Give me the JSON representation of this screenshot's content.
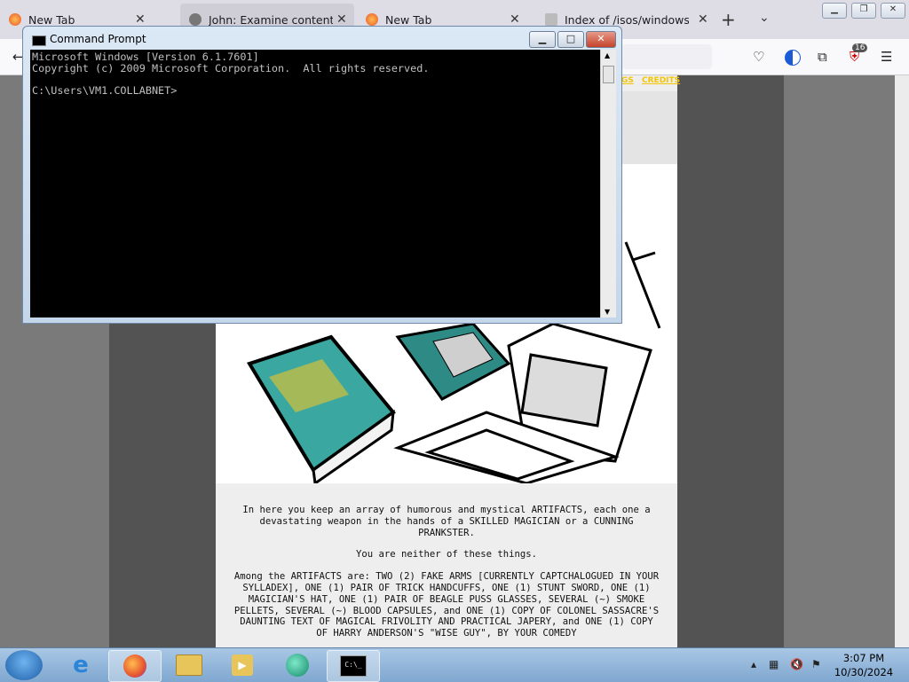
{
  "browser": {
    "tabs": [
      {
        "label": "New Tab",
        "active": false
      },
      {
        "label": "John: Examine contents of",
        "active": true
      },
      {
        "label": "New Tab",
        "active": false
      },
      {
        "label": "Index of /isos/windows/",
        "active": false
      }
    ],
    "close_glyph": "✕",
    "new_tab_glyph": "+",
    "tab_list_glyph": "⌄",
    "badge_count": "16",
    "nav_links": [
      "GS",
      "CREDITS"
    ]
  },
  "cmd": {
    "title": "Command Prompt",
    "lines": [
      "Microsoft Windows [Version 6.1.7601]",
      "Copyright (c) 2009 Microsoft Corporation.  All rights reserved.",
      "",
      "C:\\Users\\VM1.COLLABNET>"
    ]
  },
  "page": {
    "p1": "In here you keep an array of humorous and mystical ARTIFACTS, each one a devastating weapon in the hands of a SKILLED MAGICIAN or a CUNNING PRANKSTER.",
    "p2": "You are neither of these things.",
    "p3": "Among the ARTIFACTS are: TWO (2) FAKE ARMS [CURRENTLY CAPTCHALOGUED IN YOUR SYLLADEX], ONE (1) PAIR OF TRICK HANDCUFFS, ONE (1) STUNT SWORD, ONE (1) MAGICIAN'S HAT, ONE (1) PAIR OF BEAGLE PUSS GLASSES, SEVERAL (~) SMOKE PELLETS, SEVERAL (~) BLOOD CAPSULES, and ONE (1) COPY OF COLONEL SASSACRE'S DAUNTING TEXT OF MAGICAL FRIVOLITY AND PRACTICAL JAPERY, and ONE (1) COPY OF HARRY ANDERSON'S \"WISE GUY\", BY YOUR COMEDY"
  },
  "taskbar": {
    "time": "3:07 PM",
    "date": "10/30/2024",
    "cmd_icon_text": "C:\\_"
  }
}
